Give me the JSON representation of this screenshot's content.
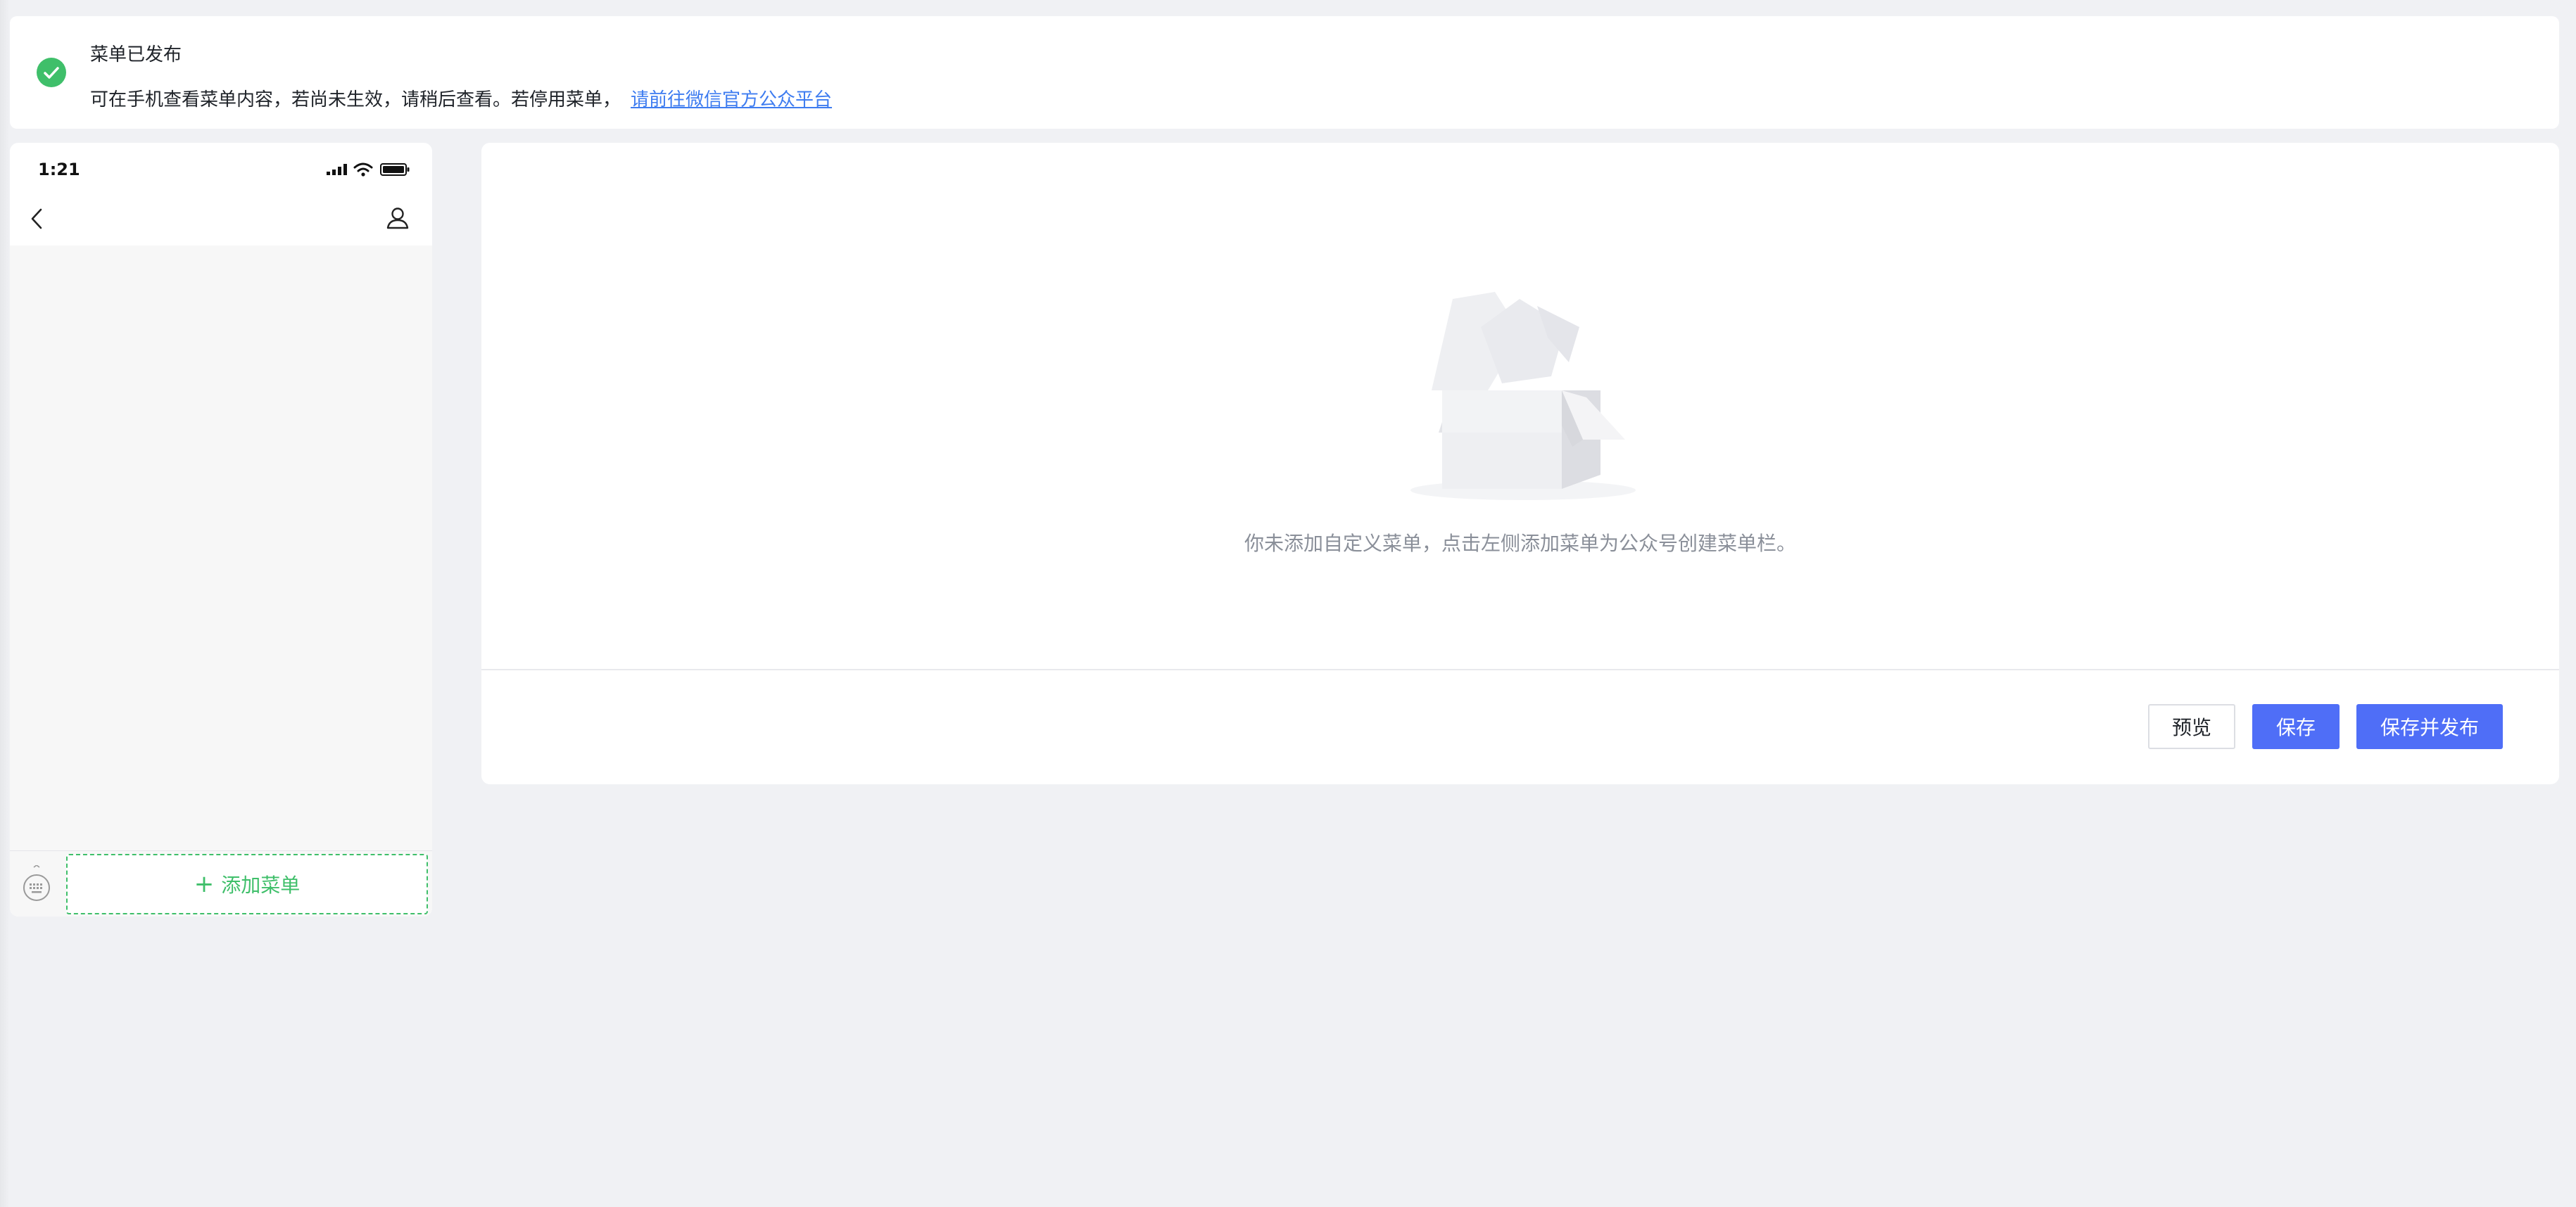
{
  "notice": {
    "title": "菜单已发布",
    "description": "可在手机查看菜单内容，若尚未生效，请稍后查看。若停用菜单，",
    "link_text": "请前往微信官方公众平台",
    "icon": "check-circle-icon",
    "status_color": "#3fbf6a"
  },
  "phone": {
    "time": "1:21",
    "add_menu_label": "添加菜单",
    "add_menu_color": "#3fbf6a"
  },
  "main": {
    "empty_text": "你未添加自定义菜单，点击左侧添加菜单为公众号创建菜单栏。"
  },
  "actions": {
    "preview_label": "预览",
    "save_label": "保存",
    "save_publish_label": "保存并发布",
    "primary_color": "#4f6ef7"
  }
}
